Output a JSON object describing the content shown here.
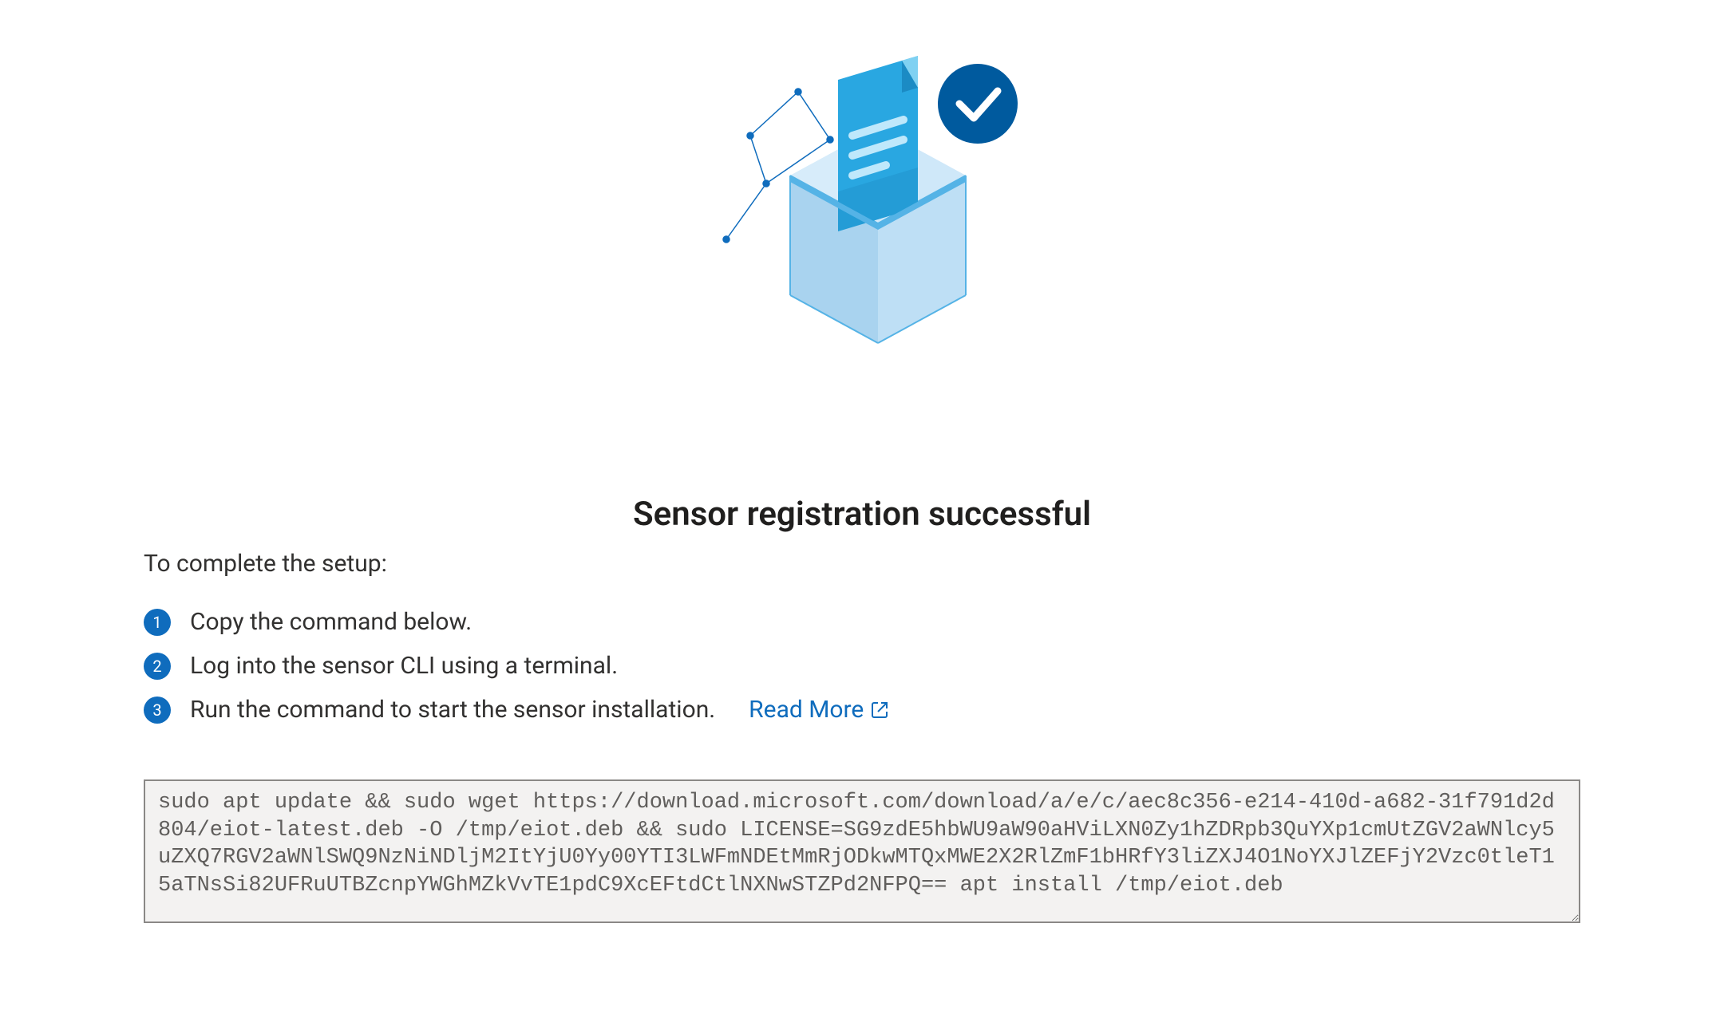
{
  "heading": "Sensor registration successful",
  "subtitle": "To complete the setup:",
  "steps": [
    {
      "num": "1",
      "text": "Copy the command below."
    },
    {
      "num": "2",
      "text": "Log into the sensor CLI using a terminal."
    },
    {
      "num": "3",
      "text": "Run the command to start the sensor installation."
    }
  ],
  "readMore": "Read More",
  "command": "sudo apt update && sudo wget https://download.microsoft.com/download/a/e/c/aec8c356-e214-410d-a682-31f791d2d804/eiot-latest.deb -O /tmp/eiot.deb && sudo LICENSE=SG9zdE5hbWU9aW90aHViLXN0Zy1hZDRpb3QuYXp1cmUtZGV2aWNlcy5uZXQ7RGV2aWNlSWQ9NzNiNDljM2ItYjU0Yy00YTI3LWFmNDEtMmRjODkwMTQxMWE2X2RlZmF1bHRfY3liZXJ4O1NoYXJlZEFjY2Vzc0tleT15aTNsSi82UFRuUTBZcnpYWGhMZkVvTE1pdC9XcEFtdCtlNXNwSTZPd2NFPQ== apt install /tmp/eiot.deb",
  "icons": {
    "checkmark": "checkmark-icon",
    "box": "deposit-box-illustration",
    "external": "open-in-new-icon"
  },
  "colors": {
    "accent": "#0f6cbd",
    "checkBg": "#005a9e"
  }
}
